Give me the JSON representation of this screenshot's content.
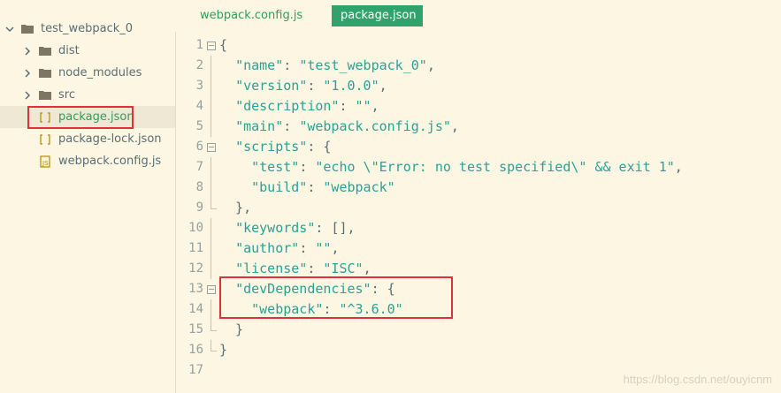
{
  "sidebar": {
    "root": "test_webpack_0",
    "items": [
      {
        "label": "dist",
        "kind": "folder"
      },
      {
        "label": "node_modules",
        "kind": "folder"
      },
      {
        "label": "src",
        "kind": "folder"
      },
      {
        "label": "package.json",
        "kind": "json",
        "selected": true
      },
      {
        "label": "package-lock.json",
        "kind": "json"
      },
      {
        "label": "webpack.config.js",
        "kind": "js"
      }
    ]
  },
  "tabs": [
    {
      "label": "webpack.config.js",
      "active": false
    },
    {
      "label": "package.json",
      "active": true
    }
  ],
  "editor": {
    "lines": [
      {
        "n": "1",
        "parts": [
          [
            "p",
            "{"
          ]
        ]
      },
      {
        "n": "2",
        "parts": [
          [
            "p",
            "  "
          ],
          [
            "k",
            "\"name\""
          ],
          [
            "p",
            ": "
          ],
          [
            "s",
            "\"test_webpack_0\""
          ],
          [
            "p",
            ","
          ]
        ]
      },
      {
        "n": "3",
        "parts": [
          [
            "p",
            "  "
          ],
          [
            "k",
            "\"version\""
          ],
          [
            "p",
            ": "
          ],
          [
            "s",
            "\"1.0.0\""
          ],
          [
            "p",
            ","
          ]
        ]
      },
      {
        "n": "4",
        "parts": [
          [
            "p",
            "  "
          ],
          [
            "k",
            "\"description\""
          ],
          [
            "p",
            ": "
          ],
          [
            "s",
            "\"\""
          ],
          [
            "p",
            ","
          ]
        ]
      },
      {
        "n": "5",
        "parts": [
          [
            "p",
            "  "
          ],
          [
            "k",
            "\"main\""
          ],
          [
            "p",
            ": "
          ],
          [
            "s",
            "\"webpack.config.js\""
          ],
          [
            "p",
            ","
          ]
        ]
      },
      {
        "n": "6",
        "parts": [
          [
            "p",
            "  "
          ],
          [
            "k",
            "\"scripts\""
          ],
          [
            "p",
            ": {"
          ]
        ]
      },
      {
        "n": "7",
        "parts": [
          [
            "p",
            "    "
          ],
          [
            "k",
            "\"test\""
          ],
          [
            "p",
            ": "
          ],
          [
            "s",
            "\"echo \\\"Error: no test specified\\\" && exit 1\""
          ],
          [
            "p",
            ","
          ]
        ]
      },
      {
        "n": "8",
        "parts": [
          [
            "p",
            "    "
          ],
          [
            "k",
            "\"build\""
          ],
          [
            "p",
            ": "
          ],
          [
            "s",
            "\"webpack\""
          ]
        ]
      },
      {
        "n": "9",
        "parts": [
          [
            "p",
            "  },"
          ]
        ]
      },
      {
        "n": "10",
        "parts": [
          [
            "p",
            "  "
          ],
          [
            "k",
            "\"keywords\""
          ],
          [
            "p",
            ": [],"
          ]
        ]
      },
      {
        "n": "11",
        "parts": [
          [
            "p",
            "  "
          ],
          [
            "k",
            "\"author\""
          ],
          [
            "p",
            ": "
          ],
          [
            "s",
            "\"\""
          ],
          [
            "p",
            ","
          ]
        ]
      },
      {
        "n": "12",
        "parts": [
          [
            "p",
            "  "
          ],
          [
            "k",
            "\"license\""
          ],
          [
            "p",
            ": "
          ],
          [
            "s",
            "\"ISC\""
          ],
          [
            "p",
            ","
          ]
        ]
      },
      {
        "n": "13",
        "parts": [
          [
            "p",
            "  "
          ],
          [
            "k",
            "\"devDependencies\""
          ],
          [
            "p",
            ": {"
          ]
        ]
      },
      {
        "n": "14",
        "parts": [
          [
            "p",
            "    "
          ],
          [
            "k",
            "\"webpack\""
          ],
          [
            "p",
            ": "
          ],
          [
            "s",
            "\"^3.6.0\""
          ]
        ]
      },
      {
        "n": "15",
        "parts": [
          [
            "p",
            "  }"
          ]
        ]
      },
      {
        "n": "16",
        "parts": [
          [
            "p",
            "}"
          ]
        ]
      },
      {
        "n": "17",
        "parts": []
      }
    ]
  },
  "watermark": "https://blog.csdn.net/ouyicnm",
  "colors": {
    "background": "#fdf6e3",
    "accent_green": "#2fa36b",
    "highlight_red": "#e0313b",
    "string_teal": "#2aa198"
  }
}
